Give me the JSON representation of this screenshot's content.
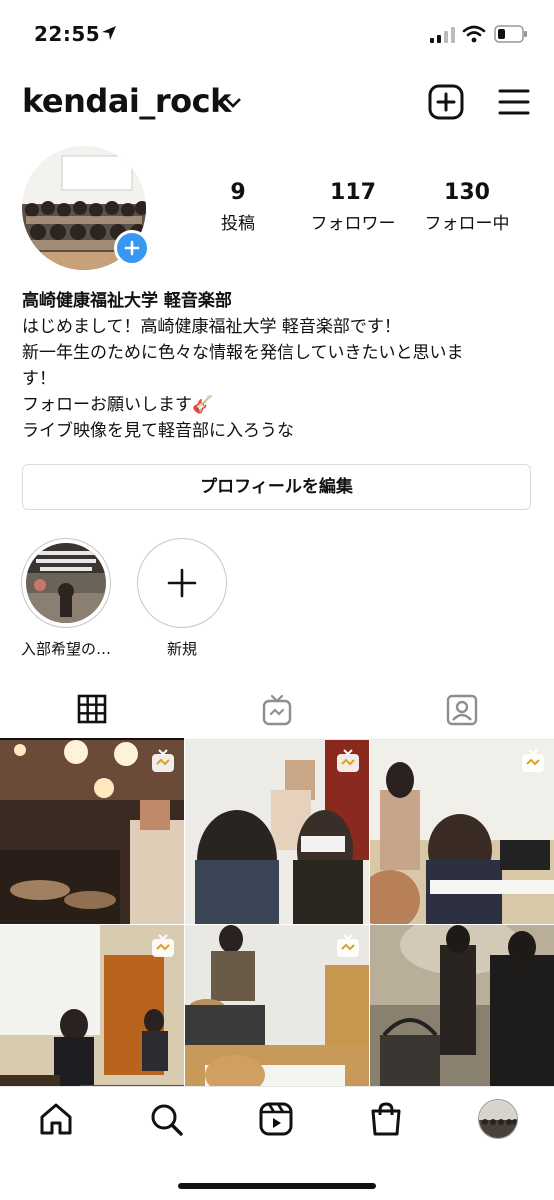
{
  "status_bar": {
    "time": "22:55"
  },
  "header": {
    "username": "kendai_rock"
  },
  "profile": {
    "stats": [
      {
        "count": "9",
        "label": "投稿"
      },
      {
        "count": "117",
        "label": "フォロワー"
      },
      {
        "count": "130",
        "label": "フォロー中"
      }
    ],
    "bio": {
      "name": "高崎健康福祉大学 軽音楽部",
      "lines": [
        "はじめまして！高崎健康福祉大学 軽音楽部です！",
        "新一年生のために色々な情報を発信していきたいと思いま",
        "す！",
        "フォローお願いします🎸",
        "ライブ映像を見て軽音部に入ろうな"
      ]
    },
    "edit_button": "プロフィールを編集"
  },
  "highlights": [
    {
      "label": "入部希望の…"
    },
    {
      "label": "新規"
    }
  ],
  "tabs": [
    "grid-icon",
    "igtv-icon",
    "tagged-icon"
  ],
  "colors": {
    "accent": "#3897f0",
    "text": "#111111",
    "border": "#dbdbdb"
  },
  "nav": [
    "home-icon",
    "search-icon",
    "reels-icon",
    "shop-icon",
    "profile-avatar"
  ]
}
